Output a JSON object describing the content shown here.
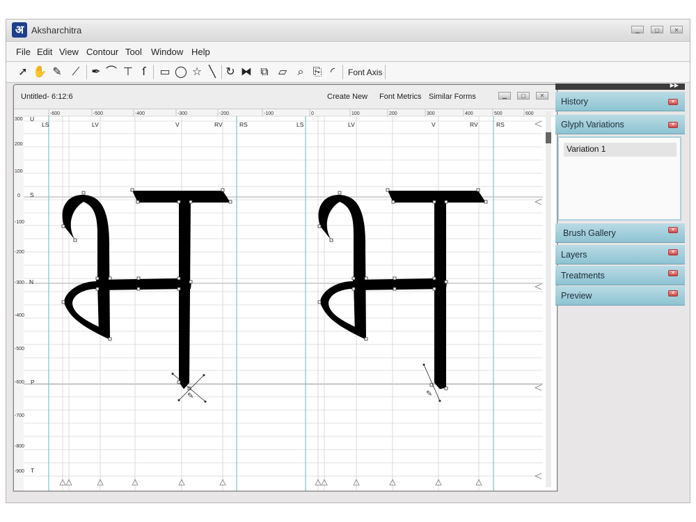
{
  "app": {
    "title": "Aksharchitra",
    "icon_glyph": "अ"
  },
  "window_buttons": [
    "minimize-icon",
    "maximize-icon",
    "close-icon"
  ],
  "menu": [
    "File",
    "Edit",
    "View",
    "Contour",
    "Tool",
    "Window",
    "Help"
  ],
  "toolbar": {
    "tools": [
      "pointer-arrow-icon",
      "hand-pan-icon",
      "eraser-icon",
      "ruler-icon",
      "pen-nib-icon",
      "curve-icon",
      "t-junction-icon",
      "hook-icon",
      "rectangle-icon",
      "ellipse-icon",
      "star-icon",
      "line-icon",
      "rotate-icon",
      "mirror-icon",
      "transform-icon",
      "skew-icon",
      "zoom-icon",
      "copy-icon",
      "quarter-shape-icon"
    ],
    "font_axis_label": "Font Axis"
  },
  "document": {
    "title": "Untitled- 6:12:6",
    "links": [
      "Create New",
      "Font Metrics",
      "Similar Forms"
    ],
    "horizontal_ruler": [
      "-600",
      "-500",
      "-400",
      "-300",
      "-200",
      "-100",
      "0",
      "100",
      "200",
      "300",
      "400",
      "500",
      "600"
    ],
    "vertical_ruler": [
      "300",
      "200",
      "100",
      "0",
      "-100",
      "-200",
      "-300",
      "-400",
      "-500",
      "-600",
      "-700",
      "-800",
      "-900"
    ],
    "guide_labels_top": [
      "LS",
      "LV",
      "V",
      "RV",
      "RS",
      "LS",
      "LV",
      "V",
      "RV",
      "RS"
    ],
    "guide_labels_left": [
      "U",
      "S",
      "N",
      "P",
      "T"
    ]
  },
  "panels": {
    "history": "History",
    "glyph_variations": "Glyph Variations",
    "variation_item": "Variation 1",
    "brush_gallery": "Brush Gallery",
    "layers": "Layers",
    "treatments": "Treatments",
    "preview": "Preview"
  },
  "colors": {
    "panel_header": "#9ccbd8",
    "close_red": "#d05353",
    "guide_cyan": "#7fc3cc",
    "glyph": "#000000"
  }
}
